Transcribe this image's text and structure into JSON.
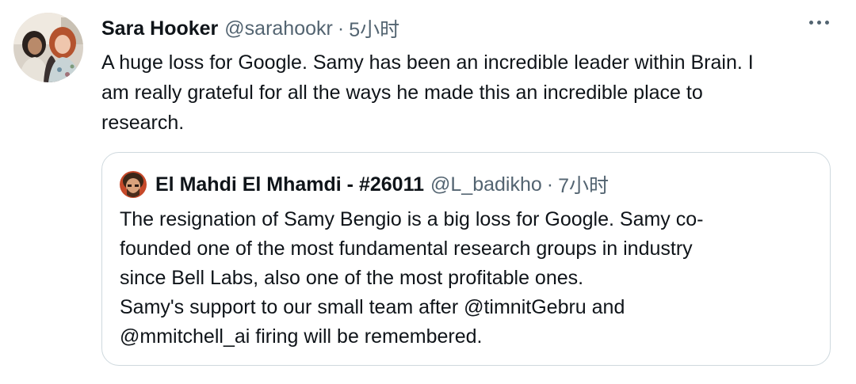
{
  "tweet": {
    "display_name": "Sara Hooker",
    "handle": "@sarahookr",
    "separator": "·",
    "time": "5小时",
    "more_icon": "more-horizontal-icon",
    "text_lines": [
      "A huge loss for Google. Samy has been an incredible leader within Brain. I",
      "am really grateful for all the ways he made this an incredible place to",
      "research."
    ]
  },
  "quote": {
    "display_name": "El Mahdi El Mhamdi - #26011",
    "handle": "@L_badikho",
    "separator": "·",
    "time": "7小时",
    "text_lines": [
      "The resignation of Samy Bengio is a big loss for Google. Samy co-",
      "founded one of the most fundamental research groups in industry",
      "since Bell Labs, also one of the most profitable ones.",
      "Samy's support to our small team after @timnitGebru and",
      "@mmitchell_ai firing will be remembered."
    ]
  },
  "colors": {
    "primary_text": "#0f1419",
    "secondary_text": "#536471",
    "border": "#cfd9de"
  }
}
